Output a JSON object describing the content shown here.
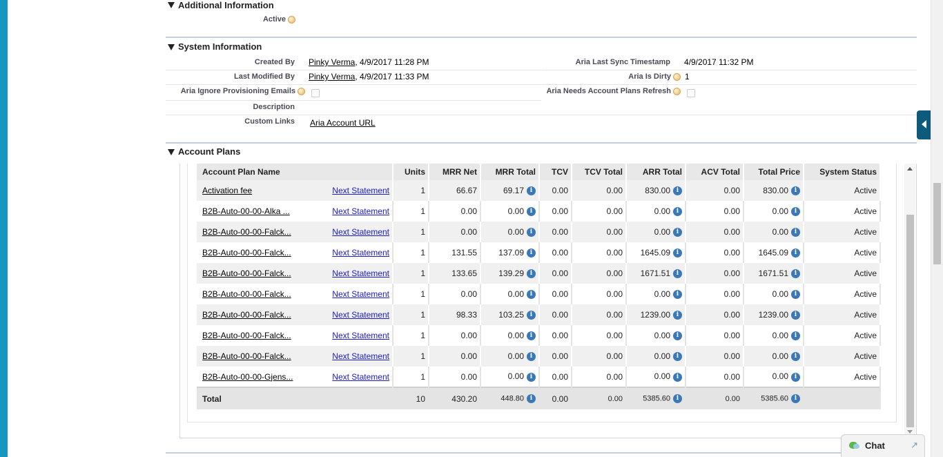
{
  "additional_info": {
    "title": "Additional Information",
    "active_label": "Active"
  },
  "system_info": {
    "title": "System Information",
    "created_by_label": "Created By",
    "created_by_user": "Pinky Verma",
    "created_by_date": ", 4/9/2017 11:28 PM",
    "last_modified_label": "Last Modified By",
    "last_modified_user": "Pinky Verma",
    "last_modified_date": ", 4/9/2017 11:33 PM",
    "aria_ignore_label": "Aria Ignore Provisioning Emails",
    "description_label": "Description",
    "custom_links_label": "Custom Links",
    "aria_account_url": "Aria Account URL",
    "aria_last_sync_label": "Aria Last Sync Timestamp",
    "aria_last_sync_value": "4/9/2017 11:32 PM",
    "aria_is_dirty_label": "Aria Is Dirty",
    "aria_is_dirty_value": "1",
    "aria_needs_refresh_label": "Aria Needs Account Plans Refresh"
  },
  "account_plans": {
    "title": "Account Plans",
    "columns": [
      "Account Plan Name",
      "Units",
      "MRR Net",
      "MRR Total",
      "TCV",
      "TCV Total",
      "ARR Total",
      "ACV Total",
      "Total Price",
      "System Status"
    ],
    "rows": [
      {
        "name": "Activation fee",
        "link": "Next Statement",
        "units": "1",
        "mrr_net": "66.67",
        "mrr_total": "69.17",
        "tcv": "0.00",
        "tcv_total": "0.00",
        "arr_total": "830.00",
        "acv_total": "0.00",
        "total_price": "830.00",
        "status": "Active"
      },
      {
        "name": "B2B-Auto-00-00-Alka ...",
        "link": "Next Statement",
        "units": "1",
        "mrr_net": "0.00",
        "mrr_total": "0.00",
        "tcv": "0.00",
        "tcv_total": "0.00",
        "arr_total": "0.00",
        "acv_total": "0.00",
        "total_price": "0.00",
        "status": "Active"
      },
      {
        "name": "B2B-Auto-00-00-Falck...",
        "link": "Next Statement",
        "units": "1",
        "mrr_net": "0.00",
        "mrr_total": "0.00",
        "tcv": "0.00",
        "tcv_total": "0.00",
        "arr_total": "0.00",
        "acv_total": "0.00",
        "total_price": "0.00",
        "status": "Active"
      },
      {
        "name": "B2B-Auto-00-00-Falck...",
        "link": "Next Statement",
        "units": "1",
        "mrr_net": "131.55",
        "mrr_total": "137.09",
        "tcv": "0.00",
        "tcv_total": "0.00",
        "arr_total": "1645.09",
        "acv_total": "0.00",
        "total_price": "1645.09",
        "status": "Active"
      },
      {
        "name": "B2B-Auto-00-00-Falck...",
        "link": "Next Statement",
        "units": "1",
        "mrr_net": "133.65",
        "mrr_total": "139.29",
        "tcv": "0.00",
        "tcv_total": "0.00",
        "arr_total": "1671.51",
        "acv_total": "0.00",
        "total_price": "1671.51",
        "status": "Active"
      },
      {
        "name": "B2B-Auto-00-00-Falck...",
        "link": "Next Statement",
        "units": "1",
        "mrr_net": "0.00",
        "mrr_total": "0.00",
        "tcv": "0.00",
        "tcv_total": "0.00",
        "arr_total": "0.00",
        "acv_total": "0.00",
        "total_price": "0.00",
        "status": "Active"
      },
      {
        "name": "B2B-Auto-00-00-Falck...",
        "link": "Next Statement",
        "units": "1",
        "mrr_net": "98.33",
        "mrr_total": "103.25",
        "tcv": "0.00",
        "tcv_total": "0.00",
        "arr_total": "1239.00",
        "acv_total": "0.00",
        "total_price": "1239.00",
        "status": "Active"
      },
      {
        "name": "B2B-Auto-00-00-Falck...",
        "link": "Next Statement",
        "units": "1",
        "mrr_net": "0.00",
        "mrr_total": "0.00",
        "tcv": "0.00",
        "tcv_total": "0.00",
        "arr_total": "0.00",
        "acv_total": "0.00",
        "total_price": "0.00",
        "status": "Active"
      },
      {
        "name": "B2B-Auto-00-00-Falck...",
        "link": "Next Statement",
        "units": "1",
        "mrr_net": "0.00",
        "mrr_total": "0.00",
        "tcv": "0.00",
        "tcv_total": "0.00",
        "arr_total": "0.00",
        "acv_total": "0.00",
        "total_price": "0.00",
        "status": "Active"
      },
      {
        "name": "B2B-Auto-00-00-Gjens...",
        "link": "Next Statement",
        "units": "1",
        "mrr_net": "0.00",
        "mrr_total": "0.00",
        "tcv": "0.00",
        "tcv_total": "0.00",
        "arr_total": "0.00",
        "acv_total": "0.00",
        "total_price": "0.00",
        "status": "Active"
      }
    ],
    "total": {
      "label": "Total",
      "units": "10",
      "mrr_net": "430.20",
      "mrr_total": "448.80",
      "tcv": "0.00",
      "tcv_total": "0.00",
      "arr_total": "5385.60",
      "acv_total": "0.00",
      "total_price": "5385.60"
    }
  },
  "icons": {
    "info_glyph": "i",
    "expand_glyph": "↗"
  },
  "chat": {
    "label": "Chat"
  }
}
